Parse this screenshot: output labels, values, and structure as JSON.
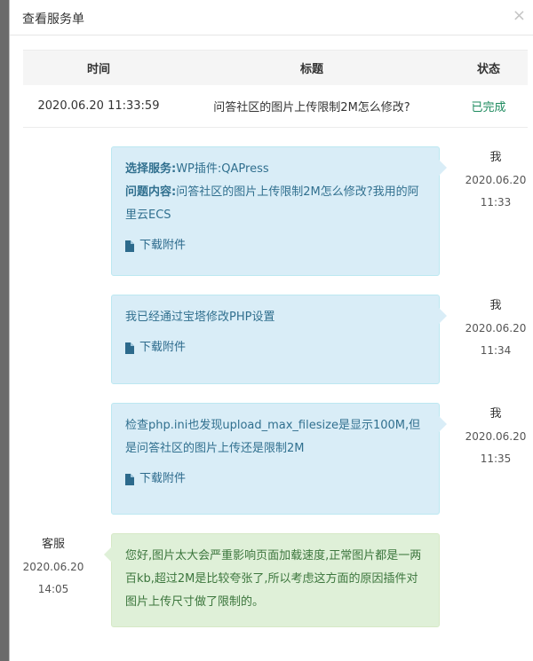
{
  "modal": {
    "title": "查看服务单",
    "close": "×"
  },
  "table": {
    "headers": [
      "时间",
      "标题",
      "状态"
    ],
    "row": {
      "time": "2020.06.20 11:33:59",
      "title": "问答社区的图片上传限制2M怎么修改?",
      "status": "已完成"
    }
  },
  "messages": [
    {
      "service_label": "选择服务:",
      "service_value": "WP插件:QAPress",
      "content_label": "问题内容:",
      "content_value": "问答社区的图片上传限制2M怎么修改?我用的阿里云ECS",
      "attachment": "下载附件",
      "sender": "我",
      "date": "2020.06.20",
      "time": "11:33"
    },
    {
      "text": "我已经通过宝塔修改PHP设置",
      "attachment": "下载附件",
      "sender": "我",
      "date": "2020.06.20",
      "time": "11:34"
    },
    {
      "text": "检查php.ini也发现upload_max_filesize是显示100M,但是问答社区的图片上传还是限制2M",
      "attachment": "下载附件",
      "sender": "我",
      "date": "2020.06.20",
      "time": "11:35"
    },
    {
      "text": "您好,图片太大会严重影响页面加载速度,正常图片都是一两百kb,超过2M是比较夸张了,所以考虑这方面的原因插件对图片上传尺寸做了限制的。",
      "sender": "客服",
      "date": "2020.06.20",
      "time": "14:05"
    }
  ],
  "colors": {
    "user_bubble": "#d9edf7",
    "staff_bubble": "#dff0d8",
    "status_done": "#1d8a5e"
  }
}
